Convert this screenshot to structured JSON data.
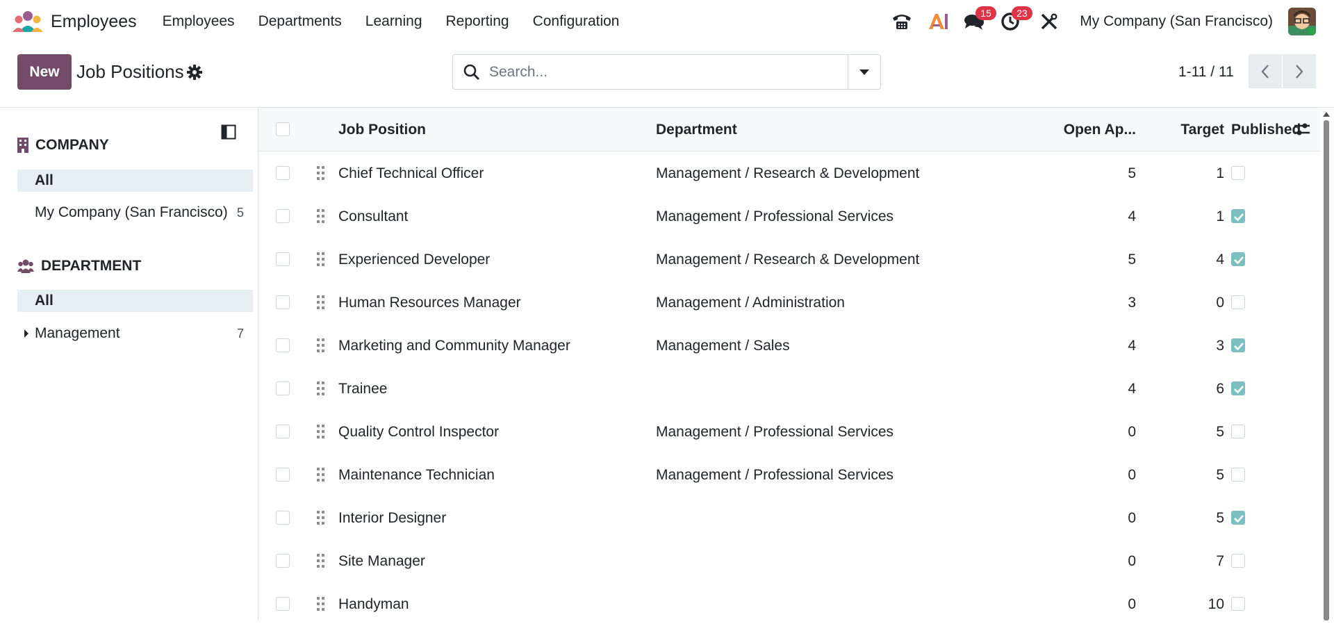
{
  "navbar": {
    "app_title": "Employees",
    "menu": [
      "Employees",
      "Departments",
      "Learning",
      "Reporting",
      "Configuration"
    ],
    "messages_badge": "15",
    "activities_badge": "23",
    "company": "My Company (San Francisco)"
  },
  "control": {
    "new_label": "New",
    "title": "Job Positions",
    "search_placeholder": "Search...",
    "pager": "1-11 / 11"
  },
  "sidepanel": {
    "company_title": "COMPANY",
    "company_items": [
      {
        "label": "All",
        "count": "",
        "active": true
      },
      {
        "label": "My Company (San Francisco)",
        "count": "5",
        "active": false
      }
    ],
    "department_title": "DEPARTMENT",
    "department_items": [
      {
        "label": "All",
        "count": "",
        "active": true
      },
      {
        "label": "Management",
        "count": "7",
        "active": false
      }
    ]
  },
  "table": {
    "headers": {
      "job_position": "Job Position",
      "department": "Department",
      "open_applications": "Open Ap...",
      "target": "Target",
      "published": "Published"
    },
    "rows": [
      {
        "job": "Chief Technical Officer",
        "department": "Management / Research & Development",
        "open": "5",
        "target": "1",
        "published": false
      },
      {
        "job": "Consultant",
        "department": "Management / Professional Services",
        "open": "4",
        "target": "1",
        "published": true
      },
      {
        "job": "Experienced Developer",
        "department": "Management / Research & Development",
        "open": "5",
        "target": "4",
        "published": true
      },
      {
        "job": "Human Resources Manager",
        "department": "Management / Administration",
        "open": "3",
        "target": "0",
        "published": false
      },
      {
        "job": "Marketing and Community Manager",
        "department": "Management / Sales",
        "open": "4",
        "target": "3",
        "published": true
      },
      {
        "job": "Trainee",
        "department": "",
        "open": "4",
        "target": "6",
        "published": true
      },
      {
        "job": "Quality Control Inspector",
        "department": "Management / Professional Services",
        "open": "0",
        "target": "5",
        "published": false
      },
      {
        "job": "Maintenance Technician",
        "department": "Management / Professional Services",
        "open": "0",
        "target": "5",
        "published": false
      },
      {
        "job": "Interior Designer",
        "department": "",
        "open": "0",
        "target": "5",
        "published": true
      },
      {
        "job": "Site Manager",
        "department": "",
        "open": "0",
        "target": "7",
        "published": false
      },
      {
        "job": "Handyman",
        "department": "",
        "open": "0",
        "target": "10",
        "published": false
      }
    ]
  },
  "colors": {
    "brand": "#714b67",
    "checkbox_checked": "#7cbfc1",
    "badge": "#dc3545",
    "active_filter_bg": "#e6f0f2"
  }
}
